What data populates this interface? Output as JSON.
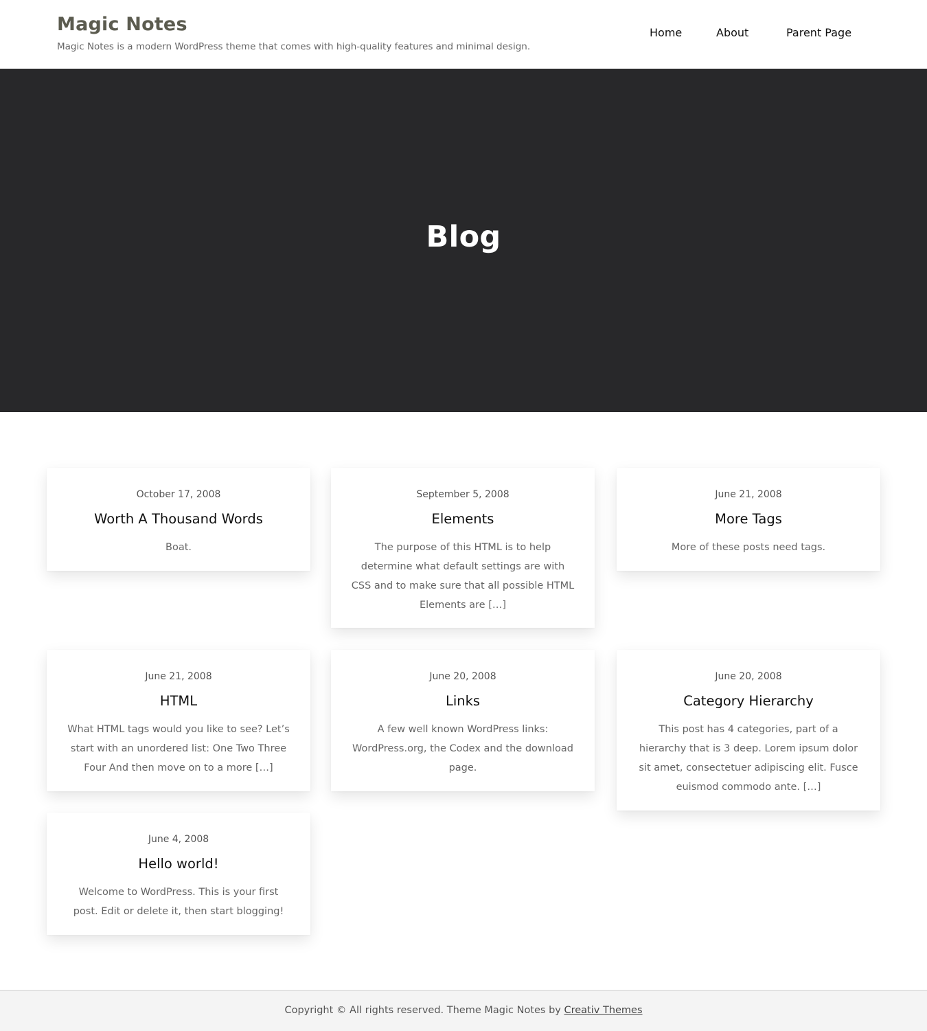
{
  "site": {
    "title": "Magic Notes",
    "tagline": "Magic Notes is a modern WordPress theme that comes with high-quality features and minimal design."
  },
  "nav": {
    "items": [
      {
        "label": "Home"
      },
      {
        "label": "About"
      },
      {
        "label": "Parent Page"
      }
    ]
  },
  "hero": {
    "title": "Blog"
  },
  "posts": [
    {
      "date": "October 17, 2008",
      "title": "Worth A Thousand Words",
      "excerpt": "Boat."
    },
    {
      "date": "September 5, 2008",
      "title": "Elements",
      "excerpt": "The purpose of this HTML is to help determine what default settings are with CSS and to make sure that all possible HTML Elements are […]"
    },
    {
      "date": "June 21, 2008",
      "title": "More Tags",
      "excerpt": "More of these posts need tags."
    },
    {
      "date": "June 21, 2008",
      "title": "HTML",
      "excerpt": "What HTML tags would you like to see? Let’s start with an unordered list: One Two Three Four And then move on to a more […]"
    },
    {
      "date": "June 20, 2008",
      "title": "Links",
      "excerpt": "A few well known WordPress links: WordPress.org, the Codex and the download page."
    },
    {
      "date": "June 20, 2008",
      "title": "Category Hierarchy",
      "excerpt": "This post has 4 categories, part of a hierarchy that is 3 deep. Lorem ipsum dolor sit amet, consectetuer adipiscing elit. Fusce euismod commodo ante. […]"
    },
    {
      "date": "June 4, 2008",
      "title": "Hello world!",
      "excerpt": "Welcome to WordPress. This is your first post. Edit or delete it, then start blogging!"
    }
  ],
  "footer": {
    "text": "Copyright © All rights reserved. Theme Magic Notes by",
    "link_label": "Creativ Themes"
  },
  "colors": {
    "hero_background": "#28282a",
    "site_title": "#5b5b4f",
    "footer_background": "#f4f4f4"
  }
}
